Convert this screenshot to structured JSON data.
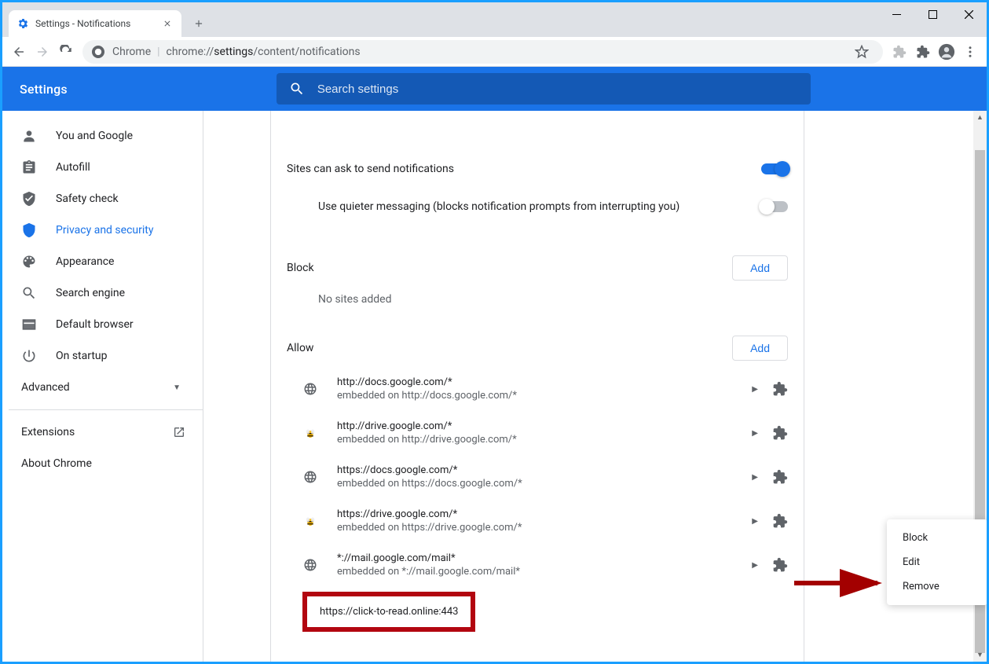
{
  "window": {
    "tab_title": "Settings - Notifications"
  },
  "toolbar": {
    "site_label": "Chrome",
    "url_pre": "chrome://",
    "url_bold": "settings",
    "url_post": "/content/notifications"
  },
  "header": {
    "title": "Settings",
    "search_placeholder": "Search settings"
  },
  "sidebar": {
    "items": [
      {
        "id": "you-and-google",
        "label": "You and Google"
      },
      {
        "id": "autofill",
        "label": "Autofill"
      },
      {
        "id": "safety-check",
        "label": "Safety check"
      },
      {
        "id": "privacy",
        "label": "Privacy and security"
      },
      {
        "id": "appearance",
        "label": "Appearance"
      },
      {
        "id": "search-engine",
        "label": "Search engine"
      },
      {
        "id": "default-browser",
        "label": "Default browser"
      },
      {
        "id": "on-startup",
        "label": "On startup"
      }
    ],
    "advanced": "Advanced",
    "extensions": "Extensions",
    "about": "About Chrome"
  },
  "content": {
    "ask_label": "Sites can ask to send notifications",
    "quieter_label": "Use quieter messaging (blocks notification prompts from interrupting you)",
    "block_title": "Block",
    "block_empty": "No sites added",
    "allow_title": "Allow",
    "add_label": "Add",
    "allow_sites": [
      {
        "url": "http://docs.google.com/*",
        "sub": "embedded on http://docs.google.com/*",
        "icon": "globe"
      },
      {
        "url": "http://drive.google.com/*",
        "sub": "embedded on http://drive.google.com/*",
        "icon": "bee"
      },
      {
        "url": "https://docs.google.com/*",
        "sub": "embedded on https://docs.google.com/*",
        "icon": "globe"
      },
      {
        "url": "https://drive.google.com/*",
        "sub": "embedded on https://drive.google.com/*",
        "icon": "bee"
      },
      {
        "url": "*://mail.google.com/mail*",
        "sub": "embedded on *://mail.google.com/mail*",
        "icon": "globe"
      }
    ],
    "highlighted_url": "https://click-to-read.online:443"
  },
  "context_menu": {
    "items": [
      "Block",
      "Edit",
      "Remove"
    ]
  }
}
